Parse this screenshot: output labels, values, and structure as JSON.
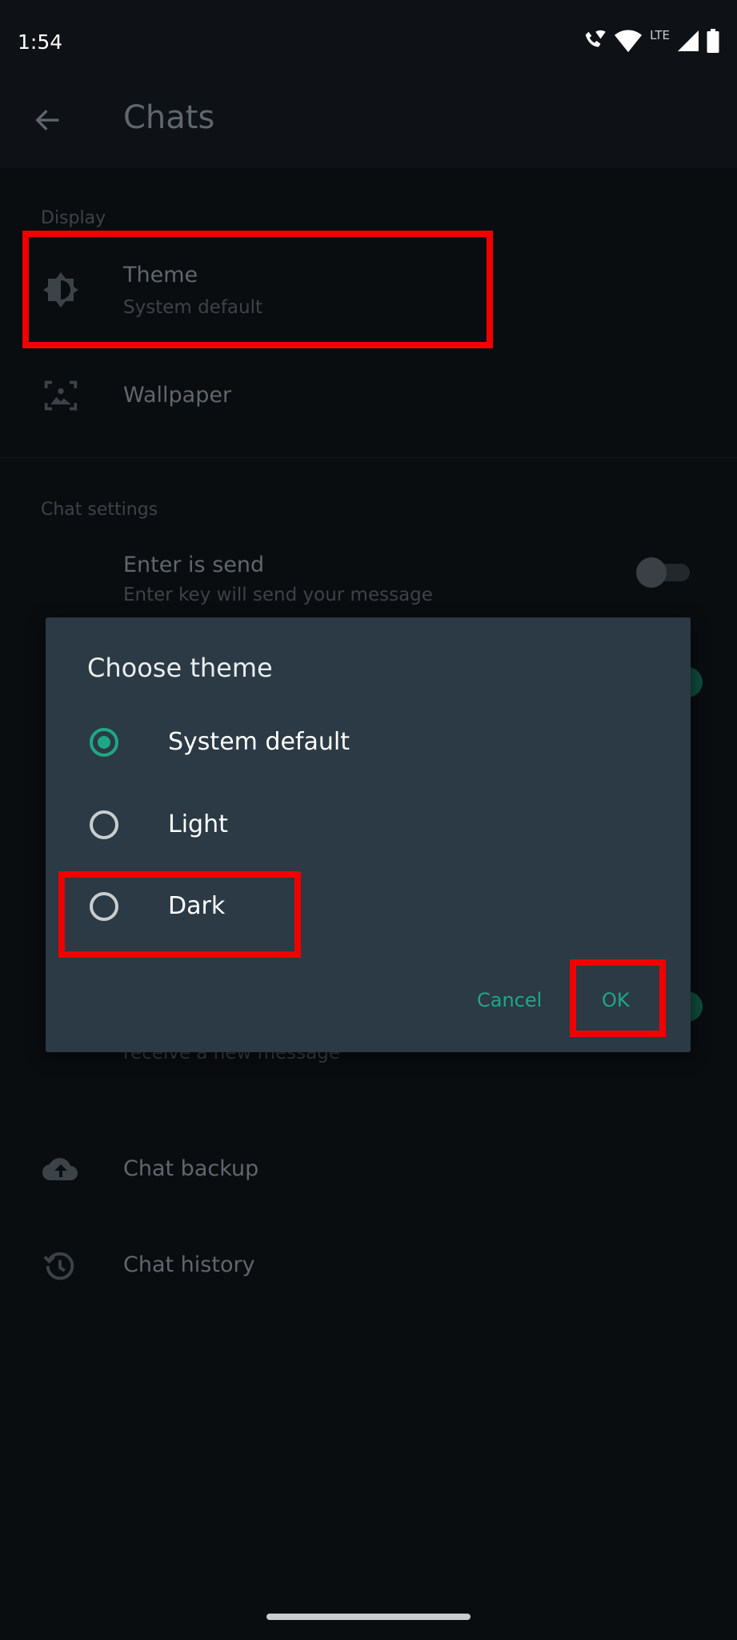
{
  "status_bar": {
    "time": "1:54",
    "network": "LTE",
    "icons": [
      "wifi-call-icon",
      "wifi-icon",
      "signal-icon",
      "battery-icon"
    ]
  },
  "app_bar": {
    "title": "Chats",
    "back_icon": "arrow-left-icon"
  },
  "sections": {
    "display": {
      "label": "Display",
      "items": [
        {
          "title": "Theme",
          "subtitle": "System default",
          "icon": "brightness-icon"
        },
        {
          "title": "Wallpaper",
          "icon": "wallpaper-icon"
        }
      ]
    },
    "chat_settings": {
      "label": "Chat settings",
      "items": [
        {
          "title": "Enter is send",
          "subtitle": "Enter key will send your message",
          "toggle": false
        }
      ],
      "partial_text": "receive a new message"
    },
    "other": [
      {
        "title": "Chat backup",
        "icon": "cloud-upload-icon"
      },
      {
        "title": "Chat history",
        "icon": "history-icon"
      }
    ]
  },
  "dialog": {
    "title": "Choose theme",
    "options": [
      {
        "label": "System default",
        "selected": true
      },
      {
        "label": "Light",
        "selected": false
      },
      {
        "label": "Dark",
        "selected": false
      }
    ],
    "cancel": "Cancel",
    "ok": "OK"
  },
  "colors": {
    "accent": "#1fa785",
    "highlight": "#f20000",
    "dialog_bg": "#2b3a44",
    "background": "#0a0d10"
  }
}
